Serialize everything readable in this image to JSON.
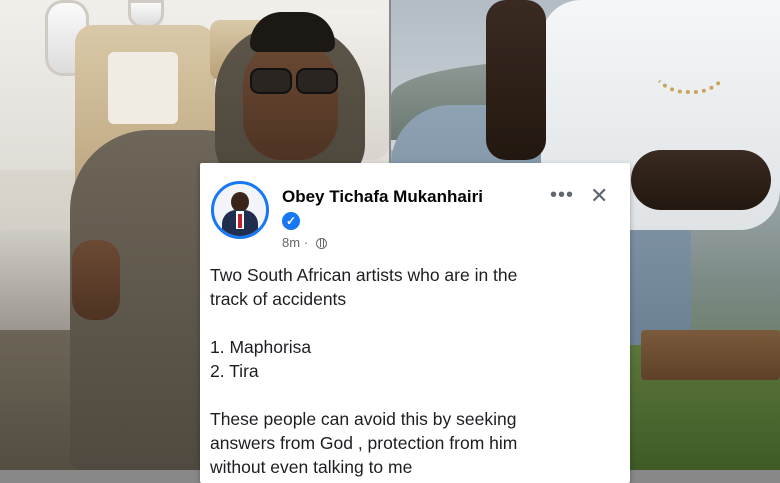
{
  "post": {
    "author": "Obey Tichafa Mukanhairi",
    "verified_icon": "check-icon",
    "time": "8m",
    "separator": "·",
    "audience_icon": "globe-icon",
    "more_icon": "•••",
    "close_icon": "✕",
    "body": {
      "line1": "Two South African artists who are in the",
      "line2": "track of accidents",
      "item1": "1. Maphorisa",
      "item2": "2. Tira",
      "line3": "These people can avoid this by seeking",
      "line4": "answers from God , protection from him",
      "line5": "without even talking to me"
    }
  },
  "colors": {
    "facebook_blue": "#1877f2",
    "text_primary": "#050505",
    "text_secondary": "#65676b"
  }
}
